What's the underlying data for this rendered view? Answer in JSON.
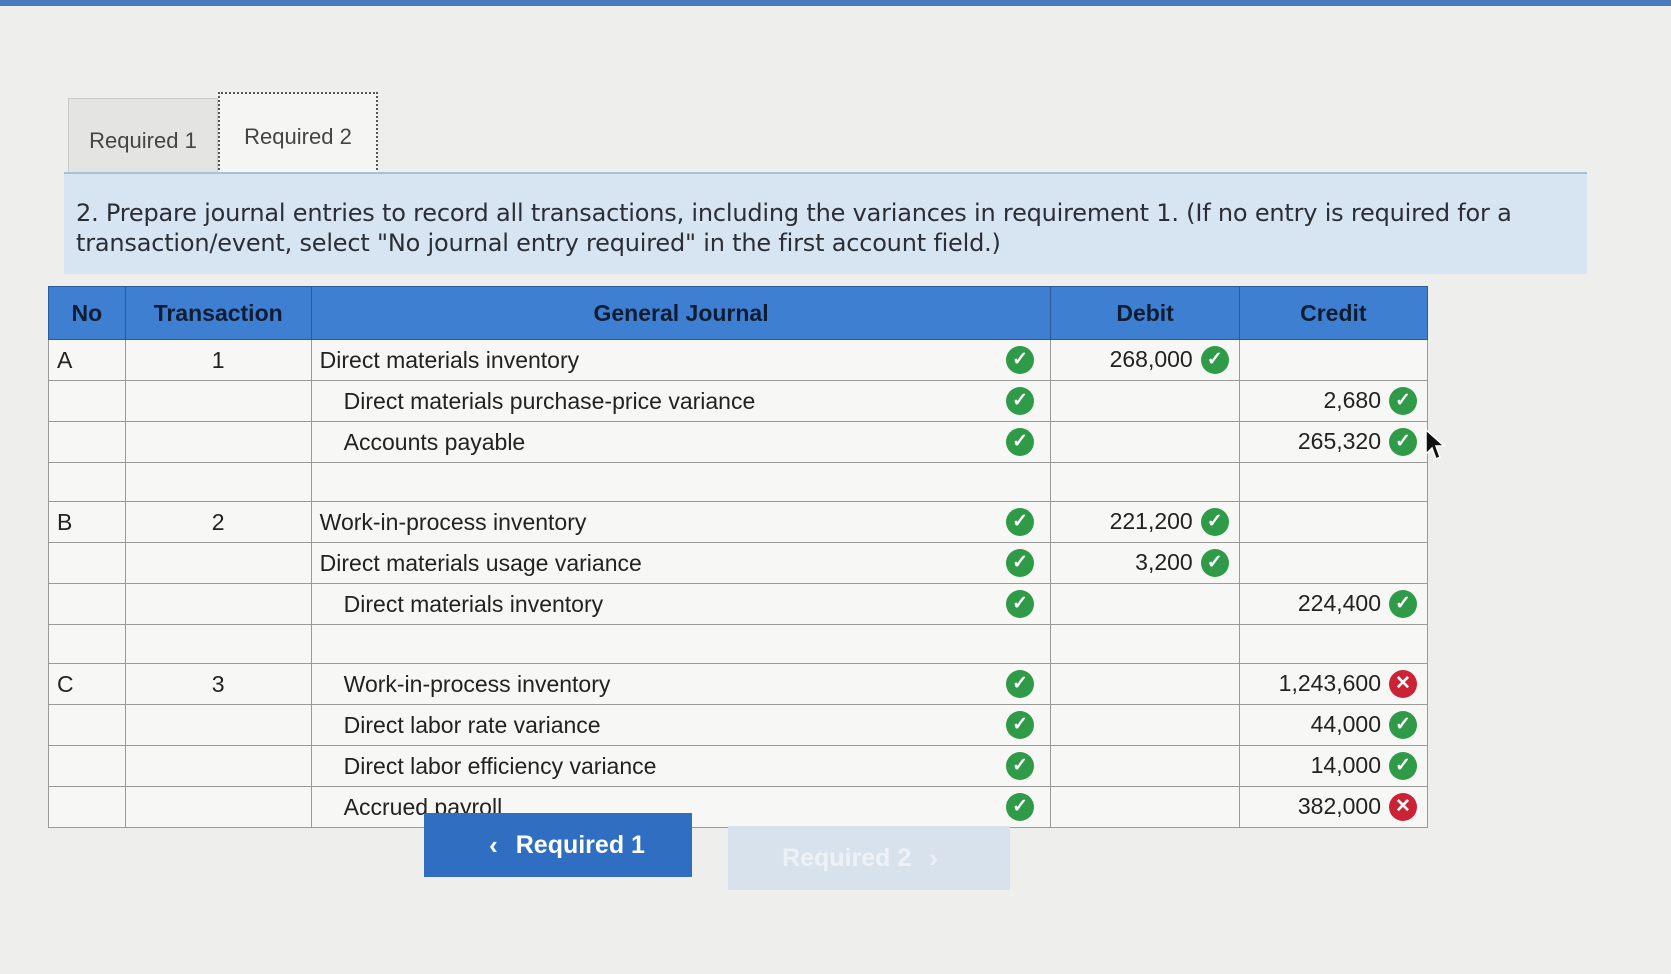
{
  "tabs": [
    {
      "label": "Required 1"
    },
    {
      "label": "Required 2"
    }
  ],
  "instruction": "2. Prepare journal entries to record all transactions, including the variances in requirement 1. (If no entry is required for a transaction/event, select \"No journal entry required\" in the first account field.)",
  "table": {
    "headers": {
      "no": "No",
      "transaction": "Transaction",
      "general_journal": "General Journal",
      "debit": "Debit",
      "credit": "Credit"
    },
    "rows": [
      {
        "no": "A",
        "transaction": "1",
        "account": "Direct materials inventory",
        "debit": "268,000",
        "credit": ""
      },
      {
        "no": "",
        "transaction": "",
        "account": "Direct materials purchase-price variance",
        "debit": "",
        "credit": "2,680"
      },
      {
        "no": "",
        "transaction": "",
        "account": "Accounts payable",
        "debit": "",
        "credit": "265,320"
      },
      {
        "no": "B",
        "transaction": "2",
        "account": "Work-in-process inventory",
        "debit": "221,200",
        "credit": ""
      },
      {
        "no": "",
        "transaction": "",
        "account": "Direct materials usage variance",
        "debit": "3,200",
        "credit": ""
      },
      {
        "no": "",
        "transaction": "",
        "account": "Direct materials inventory",
        "debit": "",
        "credit": "224,400"
      },
      {
        "no": "C",
        "transaction": "3",
        "account": "Work-in-process inventory",
        "debit": "",
        "credit": "1,243,600"
      },
      {
        "no": "",
        "transaction": "",
        "account": "Direct labor rate variance",
        "debit": "",
        "credit": "44,000"
      },
      {
        "no": "",
        "transaction": "",
        "account": "Direct labor efficiency variance",
        "debit": "",
        "credit": "14,000"
      },
      {
        "no": "",
        "transaction": "",
        "account": "Accrued payroll",
        "debit": "",
        "credit": "382,000"
      }
    ]
  },
  "nav": {
    "prev_label": "Required 1",
    "next_label": "Required 2"
  },
  "colors": {
    "header_bg": "#3f7fd1",
    "correct": "#2f9a48",
    "incorrect": "#cc2236",
    "instruction_bg": "#d7e4f1"
  },
  "icons": {
    "correct": "check-circle-icon",
    "incorrect": "x-circle-icon"
  }
}
